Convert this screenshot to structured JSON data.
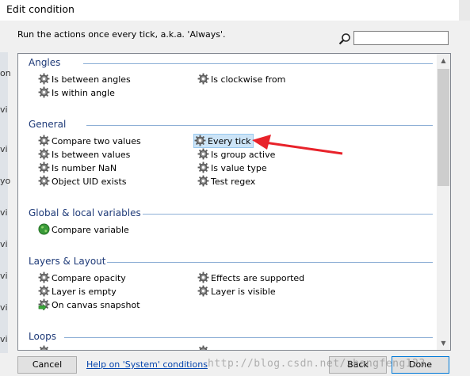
{
  "window": {
    "title": "Edit condition"
  },
  "description": "Run the actions once every tick, a.k.a. 'Always'.",
  "search": {
    "value": "",
    "placeholder": ""
  },
  "left_strip": [
    "on",
    "vi",
    "vi",
    "yo",
    "vi",
    "vi",
    "vi",
    "vi",
    "vi"
  ],
  "sections": [
    {
      "header": "Angles",
      "items": [
        {
          "label": "Is between angles",
          "icon": "gear-icon"
        },
        {
          "label": "Is clockwise from",
          "icon": "gear-icon"
        },
        {
          "label": "Is within angle",
          "icon": "gear-icon"
        }
      ]
    },
    {
      "header": "General",
      "items": [
        {
          "label": "Compare two values",
          "icon": "gear-icon"
        },
        {
          "label": "Every tick",
          "icon": "gear-icon",
          "selected": true
        },
        {
          "label": "Is between values",
          "icon": "gear-icon"
        },
        {
          "label": "Is group active",
          "icon": "gear-icon"
        },
        {
          "label": "Is number NaN",
          "icon": "gear-icon"
        },
        {
          "label": "Is value type",
          "icon": "gear-icon"
        },
        {
          "label": "Object UID exists",
          "icon": "gear-icon"
        },
        {
          "label": "Test regex",
          "icon": "gear-icon"
        }
      ]
    },
    {
      "header": "Global & local variables",
      "items": [
        {
          "label": "Compare variable",
          "icon": "globe-icon"
        }
      ]
    },
    {
      "header": "Layers & Layout",
      "items": [
        {
          "label": "Compare opacity",
          "icon": "gear-icon"
        },
        {
          "label": "Effects are supported",
          "icon": "gear-icon"
        },
        {
          "label": "Layer is empty",
          "icon": "gear-icon"
        },
        {
          "label": "Layer is visible",
          "icon": "gear-icon"
        },
        {
          "label": "On canvas snapshot",
          "icon": "trigger-gear-icon"
        }
      ]
    },
    {
      "header": "Loops",
      "items": []
    }
  ],
  "footer": {
    "cancel_label": "Cancel",
    "help_link": "Help on 'System' conditions",
    "back_label": "Back",
    "done_label": "Done",
    "watermark": "http://blog.csdn.net/zhangfeng123"
  },
  "colors": {
    "section_header": "#1e3a78",
    "section_rule": "#8eb0d6",
    "selection_bg": "#cce4f7",
    "arrow": "#e8222a",
    "link": "#0645ad"
  }
}
